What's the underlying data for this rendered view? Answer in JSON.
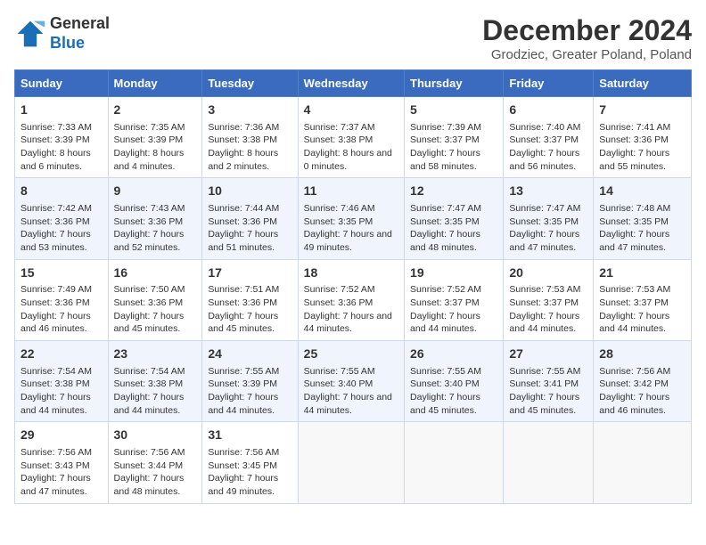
{
  "logo": {
    "line1": "General",
    "line2": "Blue"
  },
  "title": "December 2024",
  "subtitle": "Grodziec, Greater Poland, Poland",
  "days_header": [
    "Sunday",
    "Monday",
    "Tuesday",
    "Wednesday",
    "Thursday",
    "Friday",
    "Saturday"
  ],
  "weeks": [
    [
      {
        "day": "1",
        "rise": "7:33 AM",
        "set": "3:39 PM",
        "daylight": "8 hours and 6 minutes."
      },
      {
        "day": "2",
        "rise": "7:35 AM",
        "set": "3:39 PM",
        "daylight": "8 hours and 4 minutes."
      },
      {
        "day": "3",
        "rise": "7:36 AM",
        "set": "3:38 PM",
        "daylight": "8 hours and 2 minutes."
      },
      {
        "day": "4",
        "rise": "7:37 AM",
        "set": "3:38 PM",
        "daylight": "8 hours and 0 minutes."
      },
      {
        "day": "5",
        "rise": "7:39 AM",
        "set": "3:37 PM",
        "daylight": "7 hours and 58 minutes."
      },
      {
        "day": "6",
        "rise": "7:40 AM",
        "set": "3:37 PM",
        "daylight": "7 hours and 56 minutes."
      },
      {
        "day": "7",
        "rise": "7:41 AM",
        "set": "3:36 PM",
        "daylight": "7 hours and 55 minutes."
      }
    ],
    [
      {
        "day": "8",
        "rise": "7:42 AM",
        "set": "3:36 PM",
        "daylight": "7 hours and 53 minutes."
      },
      {
        "day": "9",
        "rise": "7:43 AM",
        "set": "3:36 PM",
        "daylight": "7 hours and 52 minutes."
      },
      {
        "day": "10",
        "rise": "7:44 AM",
        "set": "3:36 PM",
        "daylight": "7 hours and 51 minutes."
      },
      {
        "day": "11",
        "rise": "7:46 AM",
        "set": "3:35 PM",
        "daylight": "7 hours and 49 minutes."
      },
      {
        "day": "12",
        "rise": "7:47 AM",
        "set": "3:35 PM",
        "daylight": "7 hours and 48 minutes."
      },
      {
        "day": "13",
        "rise": "7:47 AM",
        "set": "3:35 PM",
        "daylight": "7 hours and 47 minutes."
      },
      {
        "day": "14",
        "rise": "7:48 AM",
        "set": "3:35 PM",
        "daylight": "7 hours and 47 minutes."
      }
    ],
    [
      {
        "day": "15",
        "rise": "7:49 AM",
        "set": "3:36 PM",
        "daylight": "7 hours and 46 minutes."
      },
      {
        "day": "16",
        "rise": "7:50 AM",
        "set": "3:36 PM",
        "daylight": "7 hours and 45 minutes."
      },
      {
        "day": "17",
        "rise": "7:51 AM",
        "set": "3:36 PM",
        "daylight": "7 hours and 45 minutes."
      },
      {
        "day": "18",
        "rise": "7:52 AM",
        "set": "3:36 PM",
        "daylight": "7 hours and 44 minutes."
      },
      {
        "day": "19",
        "rise": "7:52 AM",
        "set": "3:37 PM",
        "daylight": "7 hours and 44 minutes."
      },
      {
        "day": "20",
        "rise": "7:53 AM",
        "set": "3:37 PM",
        "daylight": "7 hours and 44 minutes."
      },
      {
        "day": "21",
        "rise": "7:53 AM",
        "set": "3:37 PM",
        "daylight": "7 hours and 44 minutes."
      }
    ],
    [
      {
        "day": "22",
        "rise": "7:54 AM",
        "set": "3:38 PM",
        "daylight": "7 hours and 44 minutes."
      },
      {
        "day": "23",
        "rise": "7:54 AM",
        "set": "3:38 PM",
        "daylight": "7 hours and 44 minutes."
      },
      {
        "day": "24",
        "rise": "7:55 AM",
        "set": "3:39 PM",
        "daylight": "7 hours and 44 minutes."
      },
      {
        "day": "25",
        "rise": "7:55 AM",
        "set": "3:40 PM",
        "daylight": "7 hours and 44 minutes."
      },
      {
        "day": "26",
        "rise": "7:55 AM",
        "set": "3:40 PM",
        "daylight": "7 hours and 45 minutes."
      },
      {
        "day": "27",
        "rise": "7:55 AM",
        "set": "3:41 PM",
        "daylight": "7 hours and 45 minutes."
      },
      {
        "day": "28",
        "rise": "7:56 AM",
        "set": "3:42 PM",
        "daylight": "7 hours and 46 minutes."
      }
    ],
    [
      {
        "day": "29",
        "rise": "7:56 AM",
        "set": "3:43 PM",
        "daylight": "7 hours and 47 minutes."
      },
      {
        "day": "30",
        "rise": "7:56 AM",
        "set": "3:44 PM",
        "daylight": "7 hours and 48 minutes."
      },
      {
        "day": "31",
        "rise": "7:56 AM",
        "set": "3:45 PM",
        "daylight": "7 hours and 49 minutes."
      },
      null,
      null,
      null,
      null
    ]
  ]
}
